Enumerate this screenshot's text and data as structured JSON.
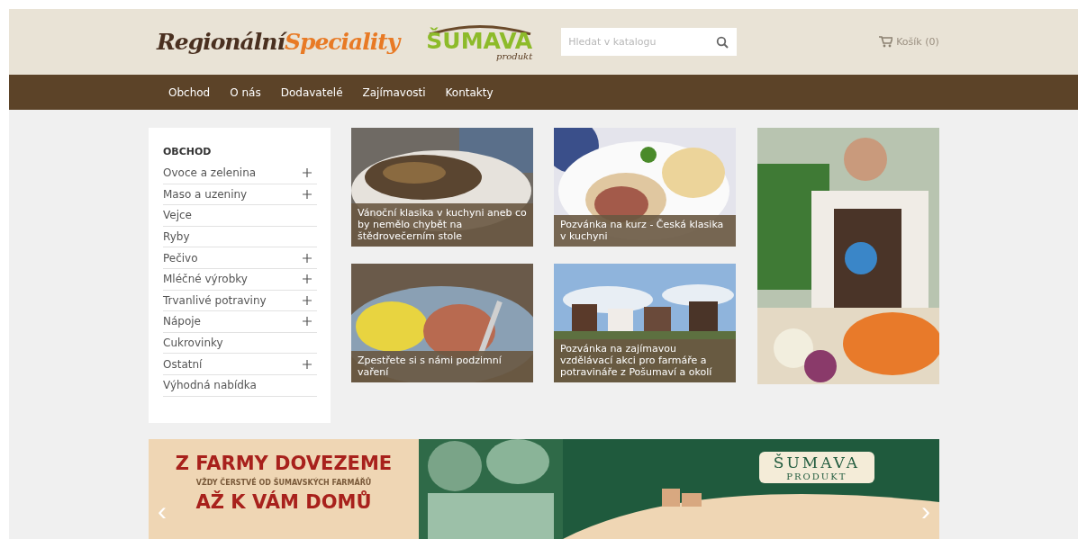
{
  "header": {
    "logo": {
      "first": "Regionální",
      "second": "Speciality"
    },
    "partner_logo": {
      "name": "ŠUMAVA",
      "tagline": "produkt"
    },
    "search": {
      "placeholder": "Hledat v katalogu"
    },
    "cart": {
      "label": "Košík (0)"
    }
  },
  "nav": [
    {
      "label": "Obchod"
    },
    {
      "label": "O nás"
    },
    {
      "label": "Dodavatelé"
    },
    {
      "label": "Zajímavosti"
    },
    {
      "label": "Kontakty"
    }
  ],
  "sidebar": {
    "title": "OBCHOD",
    "items": [
      {
        "label": "Ovoce a zelenina",
        "expandable": true
      },
      {
        "label": "Maso a uzeniny",
        "expandable": true
      },
      {
        "label": "Vejce",
        "expandable": false
      },
      {
        "label": "Ryby",
        "expandable": false
      },
      {
        "label": "Pečivo",
        "expandable": true
      },
      {
        "label": "Mléčné výrobky",
        "expandable": true
      },
      {
        "label": "Trvanlivé potraviny",
        "expandable": true
      },
      {
        "label": "Nápoje",
        "expandable": true
      },
      {
        "label": "Cukrovinky",
        "expandable": false
      },
      {
        "label": "Ostatní",
        "expandable": true
      },
      {
        "label": "Výhodná nabídka",
        "expandable": false
      }
    ]
  },
  "articles": [
    {
      "title": "Vánoční klasika v kuchyni aneb co by nemělo chybět na štědrovečerním stole",
      "kind": "grain"
    },
    {
      "title": "Pozvánka na kurz - Česká klasika v kuchyni",
      "kind": "plate"
    },
    {
      "title": "Zpestřete si s námi podzimní vaření",
      "kind": "meat"
    },
    {
      "title": "Pozvánka na zajímavou vzdělávací akci pro farmáře a potravináře z Pošumaví a okolí",
      "kind": "cows"
    }
  ],
  "banner": {
    "headline": "Z FARMY DOVEZEME",
    "subline": "VŽDY ČERSTVÉ OD ŠUMAVSKÝCH FARMÁŘŮ",
    "closing": "AŽ K VÁM DOMŮ",
    "badge_title": "ŠUMAVA",
    "badge_subtitle": "PRODUKT",
    "prev": "‹",
    "next": "›"
  }
}
